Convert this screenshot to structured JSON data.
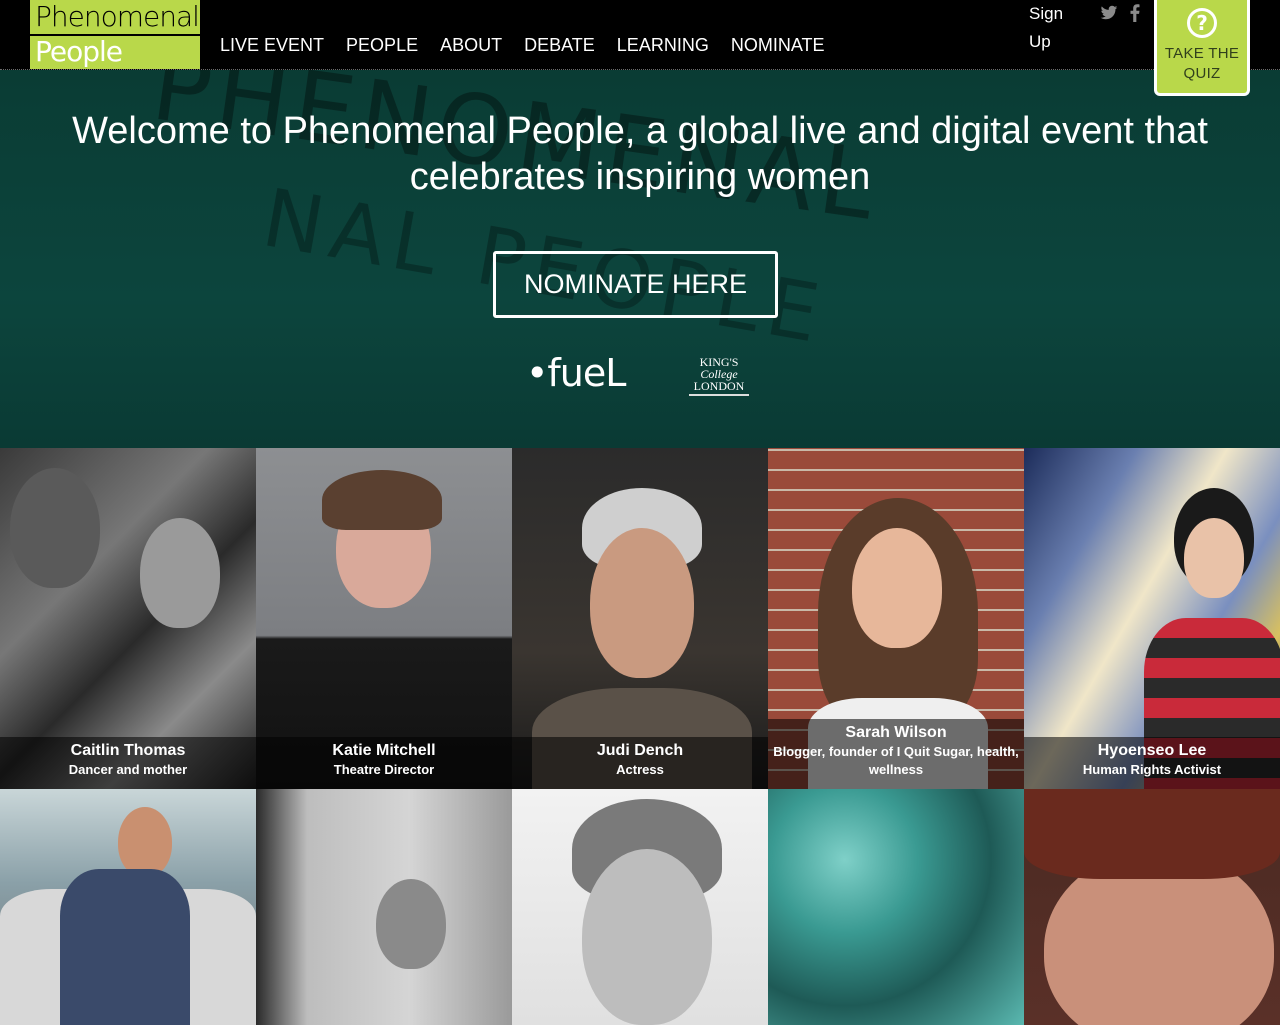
{
  "header": {
    "logo_line1": "Phenomenal",
    "logo_line2": "People",
    "nav": [
      "LIVE EVENT",
      "PEOPLE",
      "ABOUT",
      "DEBATE",
      "LEARNING",
      "NOMINATE"
    ],
    "signup": "Sign Up",
    "social_icons": [
      "twitter-icon",
      "facebook-icon"
    ],
    "quiz_symbol": "?",
    "quiz_label": "TAKE THE QUIZ"
  },
  "hero": {
    "title": "Welcome to Phenomenal People, a global live and digital event that celebrates inspiring women",
    "cta": "NOMINATE HERE",
    "sponsors": {
      "fuel": "•fueL",
      "kings_line1": "KING'S",
      "kings_line2": "College",
      "kings_line3": "LONDON"
    }
  },
  "people": [
    {
      "name": "Caitlin Thomas",
      "role": "Dancer and mother"
    },
    {
      "name": "Katie Mitchell",
      "role": "Theatre Director"
    },
    {
      "name": "Judi Dench",
      "role": "Actress"
    },
    {
      "name": "Sarah Wilson",
      "role": "Blogger, founder of I Quit Sugar, health, wellness"
    },
    {
      "name": "Hyoenseo Lee",
      "role": "Human Rights Activist"
    }
  ],
  "colors": {
    "brand_green": "#b9d84a",
    "hero_teal": "#0c3b35"
  }
}
